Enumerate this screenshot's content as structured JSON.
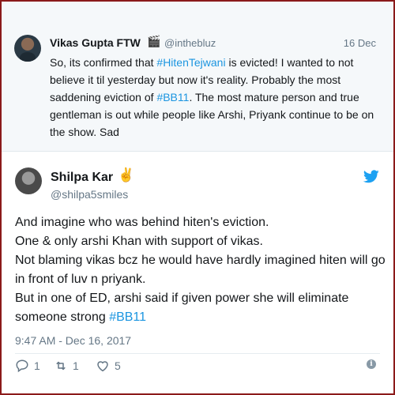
{
  "quoted_tweet": {
    "display_name": "Vikas Gupta FTW",
    "name_emoji": "🎬",
    "handle": "@inthebluz",
    "date": "16 Dec",
    "text_parts": {
      "p1": "So, its confirmed that ",
      "tag1": "#HitenTejwani",
      "p2": " is evicted! I wanted to not believe it til yesterday but now it's reality. Probably the most saddening eviction of ",
      "tag2": "#BB11",
      "p3": ". The most mature person and true gentleman is out while people like Arshi, Priyank continue to be on the show. Sad"
    }
  },
  "main_tweet": {
    "display_name": "Shilpa Kar",
    "name_emoji": "✌",
    "handle": "@shilpa5smiles",
    "lines": [
      "And imagine who was behind hiten's eviction.",
      "One & only arshi Khan with support of vikas.",
      "Not blaming vikas bcz he would have hardly imagined hiten will go in front of luv n priyank.",
      "But in one of ED, arshi said if given power she will eliminate someone strong "
    ],
    "hashtag": "#BB11",
    "timestamp": "9:47 AM - Dec 16, 2017",
    "replies": "1",
    "retweets": "1",
    "likes": "5",
    "info_glyph": "i"
  },
  "colors": {
    "link": "#1b95e0",
    "muted": "#657786",
    "frame": "#8b1a1a",
    "card_bg": "#f5f8fa"
  },
  "icons": [
    "reply-icon",
    "retweet-icon",
    "like-icon",
    "twitter-bird-icon",
    "info-icon"
  ]
}
